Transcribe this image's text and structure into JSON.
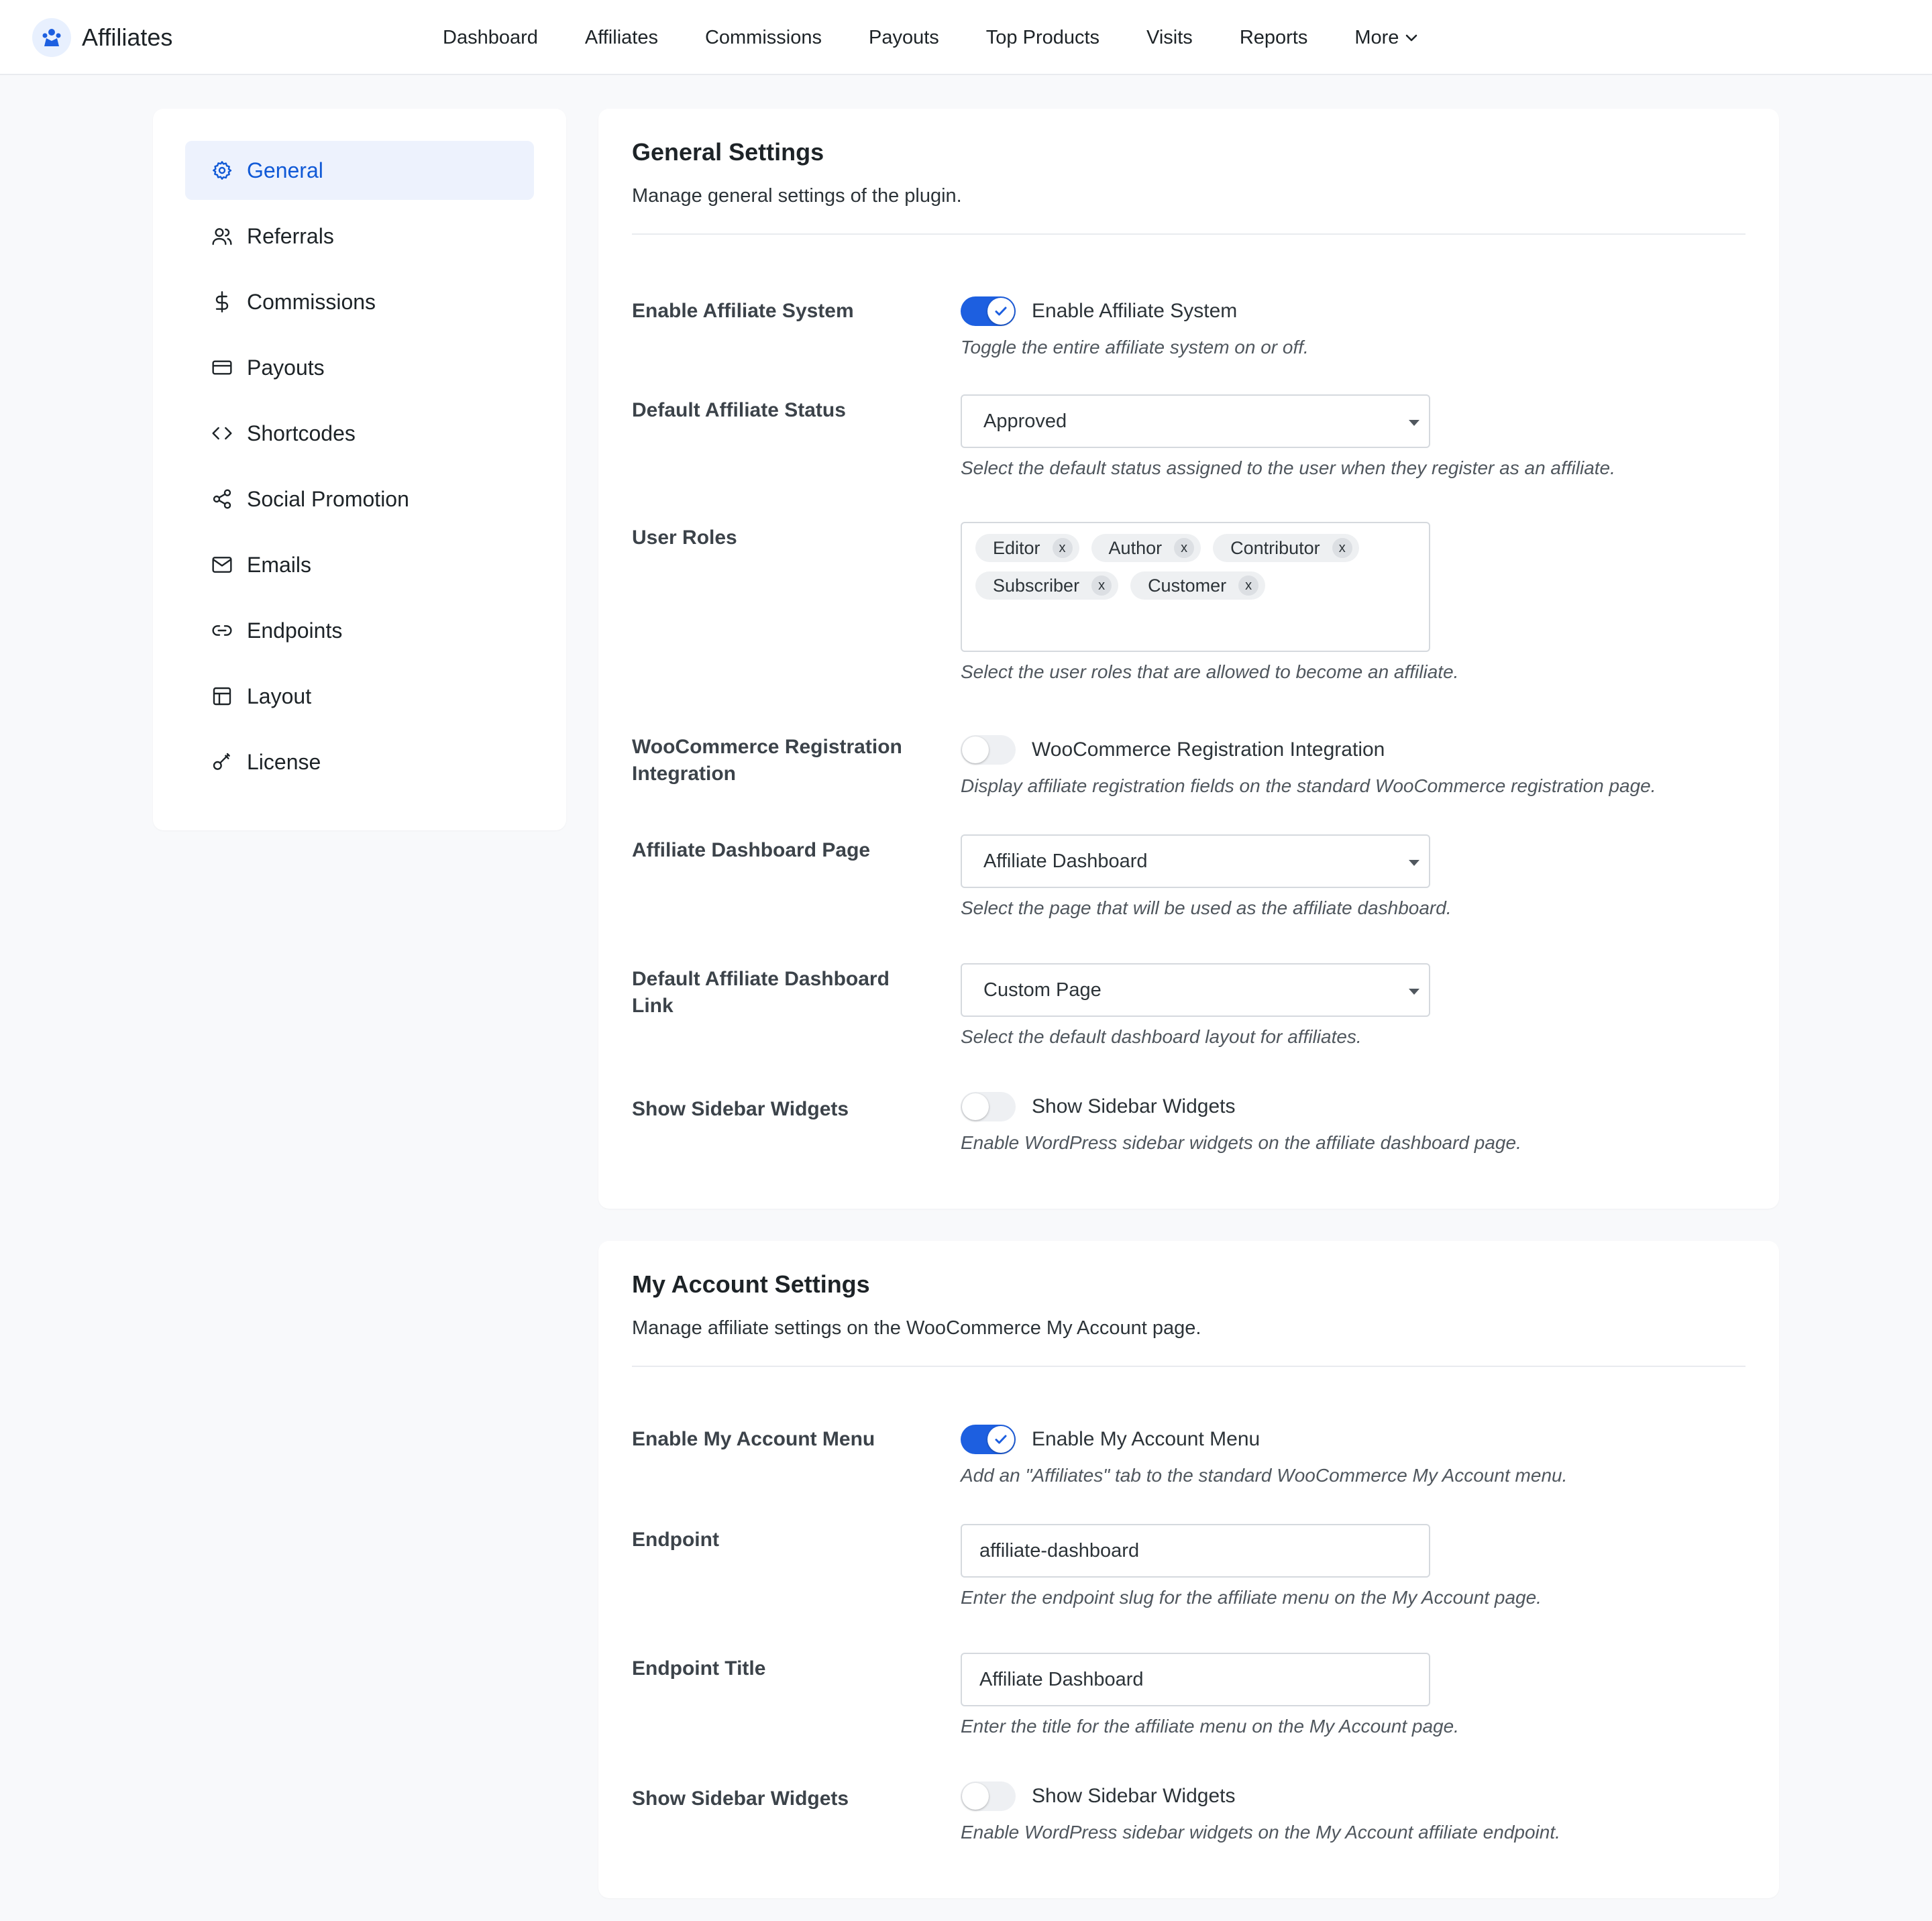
{
  "brand": {
    "name": "Affiliates"
  },
  "nav": {
    "items": [
      "Dashboard",
      "Affiliates",
      "Commissions",
      "Payouts",
      "Top Products",
      "Visits",
      "Reports"
    ],
    "more_label": "More"
  },
  "sidebar": {
    "items": [
      {
        "label": "General",
        "icon": "gear-icon",
        "active": true
      },
      {
        "label": "Referrals",
        "icon": "users-icon"
      },
      {
        "label": "Commissions",
        "icon": "dollar-icon"
      },
      {
        "label": "Payouts",
        "icon": "card-icon"
      },
      {
        "label": "Shortcodes",
        "icon": "code-icon"
      },
      {
        "label": "Social Promotion",
        "icon": "share-icon"
      },
      {
        "label": "Emails",
        "icon": "mail-icon"
      },
      {
        "label": "Endpoints",
        "icon": "link-icon"
      },
      {
        "label": "Layout",
        "icon": "layout-icon"
      },
      {
        "label": "License",
        "icon": "key-icon"
      }
    ]
  },
  "general": {
    "title": "General Settings",
    "subtitle": "Manage general settings of the plugin.",
    "enable_system": {
      "label": "Enable Affiliate System",
      "toggle_text": "Enable Affiliate System",
      "checked": true,
      "help": "Toggle the entire affiliate system on or off."
    },
    "default_status": {
      "label": "Default Affiliate Status",
      "value": "Approved",
      "help": "Select the default status assigned to the user when they register as an affiliate."
    },
    "user_roles": {
      "label": "User Roles",
      "tags": [
        "Editor",
        "Author",
        "Contributor",
        "Subscriber",
        "Customer"
      ],
      "remove_symbol": "x",
      "help": "Select the user roles that are allowed to become an affiliate."
    },
    "woo_registration": {
      "label": "WooCommerce Registration Integration",
      "toggle_text": "WooCommerce Registration Integration",
      "checked": false,
      "help": "Display affiliate registration fields on the standard WooCommerce registration page."
    },
    "dashboard_page": {
      "label": "Affiliate Dashboard Page",
      "value": "Affiliate Dashboard",
      "help": "Select the page that will be used as the affiliate dashboard."
    },
    "dashboard_link": {
      "label": "Default Affiliate Dashboard Link",
      "value": "Custom Page",
      "help": "Select the default dashboard layout for affiliates."
    },
    "sidebar_widgets": {
      "label": "Show Sidebar Widgets",
      "toggle_text": "Show Sidebar Widgets",
      "checked": false,
      "help": "Enable WordPress sidebar widgets on the affiliate dashboard page."
    }
  },
  "my_account": {
    "title": "My Account Settings",
    "subtitle": "Manage affiliate settings on the WooCommerce My Account page.",
    "enable_menu": {
      "label": "Enable My Account Menu",
      "toggle_text": "Enable My Account Menu",
      "checked": true,
      "help": "Add an \"Affiliates\" tab to the standard WooCommerce My Account menu."
    },
    "endpoint": {
      "label": "Endpoint",
      "value": "affiliate-dashboard",
      "help": "Enter the endpoint slug for the affiliate menu on the My Account page."
    },
    "endpoint_title": {
      "label": "Endpoint Title",
      "value": "Affiliate Dashboard",
      "help": "Enter the title for the affiliate menu on the My Account page."
    },
    "sidebar_widgets": {
      "label": "Show Sidebar Widgets",
      "toggle_text": "Show Sidebar Widgets",
      "checked": false,
      "help": "Enable WordPress sidebar widgets on the My Account affiliate endpoint."
    }
  },
  "colors": {
    "accent": "#1d5fe0",
    "active_bg": "#edf2fd",
    "active_text": "#1059d6"
  }
}
